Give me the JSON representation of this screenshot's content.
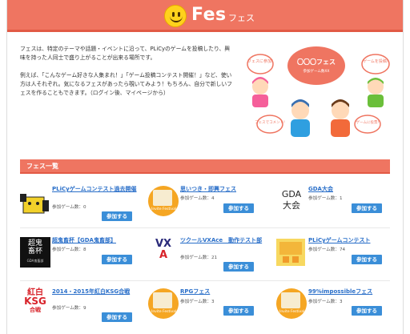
{
  "header": {
    "title": "Fes",
    "subtitle": "フェス"
  },
  "intro": {
    "p1": "フェスは、特定のテーマや話題・イベントに沿って、PLiCyのゲームを投稿したり、興味を持った人同士で盛り上がることが出来る場所です。",
    "p2": "例えば、「こんなゲーム好きな人集まれ！」「ゲーム投稿コンテスト開催！」など、使い方は人それぞれ。気になるフェスがあったら覗いてみよう！もちろん、自分で新しいフェスを作ることもできます。（ログイン後、マイページから）"
  },
  "illustration": {
    "center_title": "〇〇〇フェス",
    "center_sub": "参加ゲーム数XX",
    "bubble_left": "フェスに参加!",
    "bubble_right": "ゲームを投稿!",
    "bubble_bl": "フェスでコメント!",
    "bubble_br": "ゲームに投票!"
  },
  "section": {
    "title": "フェス一覧"
  },
  "join_label": "参加する",
  "badge_tag": "Invite Festival",
  "fes_list": [
    {
      "title": "PLiCyゲームコンテスト過去開催",
      "count": "参加ゲーム数：0"
    },
    {
      "title": "思いつき・即興フェス",
      "count": "参加ゲーム数：4"
    },
    {
      "title": "GDA大会",
      "count": "参加ゲーム数：1"
    },
    {
      "title": "超鬼畜杯【GDA鬼畜部】",
      "count": "参加ゲーム数：8"
    },
    {
      "title": "ツクールVXAce　動作テスト部",
      "count": "参加ゲーム数：21"
    },
    {
      "title": "PLiCyゲームコンテスト",
      "count": "参加ゲーム数：74"
    },
    {
      "title": "2014・2015年紅白KSG合戦",
      "count": "参加ゲーム数：9"
    },
    {
      "title": "RPGフェス",
      "count": "参加ゲーム数：3"
    },
    {
      "title": "99%impossibleフェス",
      "count": "参加ゲーム数：3"
    }
  ],
  "thumb_text": {
    "gda": "GDA\n大会",
    "kichiku1": "超鬼",
    "kichiku2": "畜杯",
    "kichiku_sub": "GDA鬼畜部",
    "vx": "VX",
    "a": "A",
    "kouhaku1": "紅白",
    "ksg": "KSG",
    "kassen": "合戦"
  },
  "colors": {
    "accent": "#ef7561",
    "button": "#3a8ed8",
    "link": "#2a6fc9"
  }
}
